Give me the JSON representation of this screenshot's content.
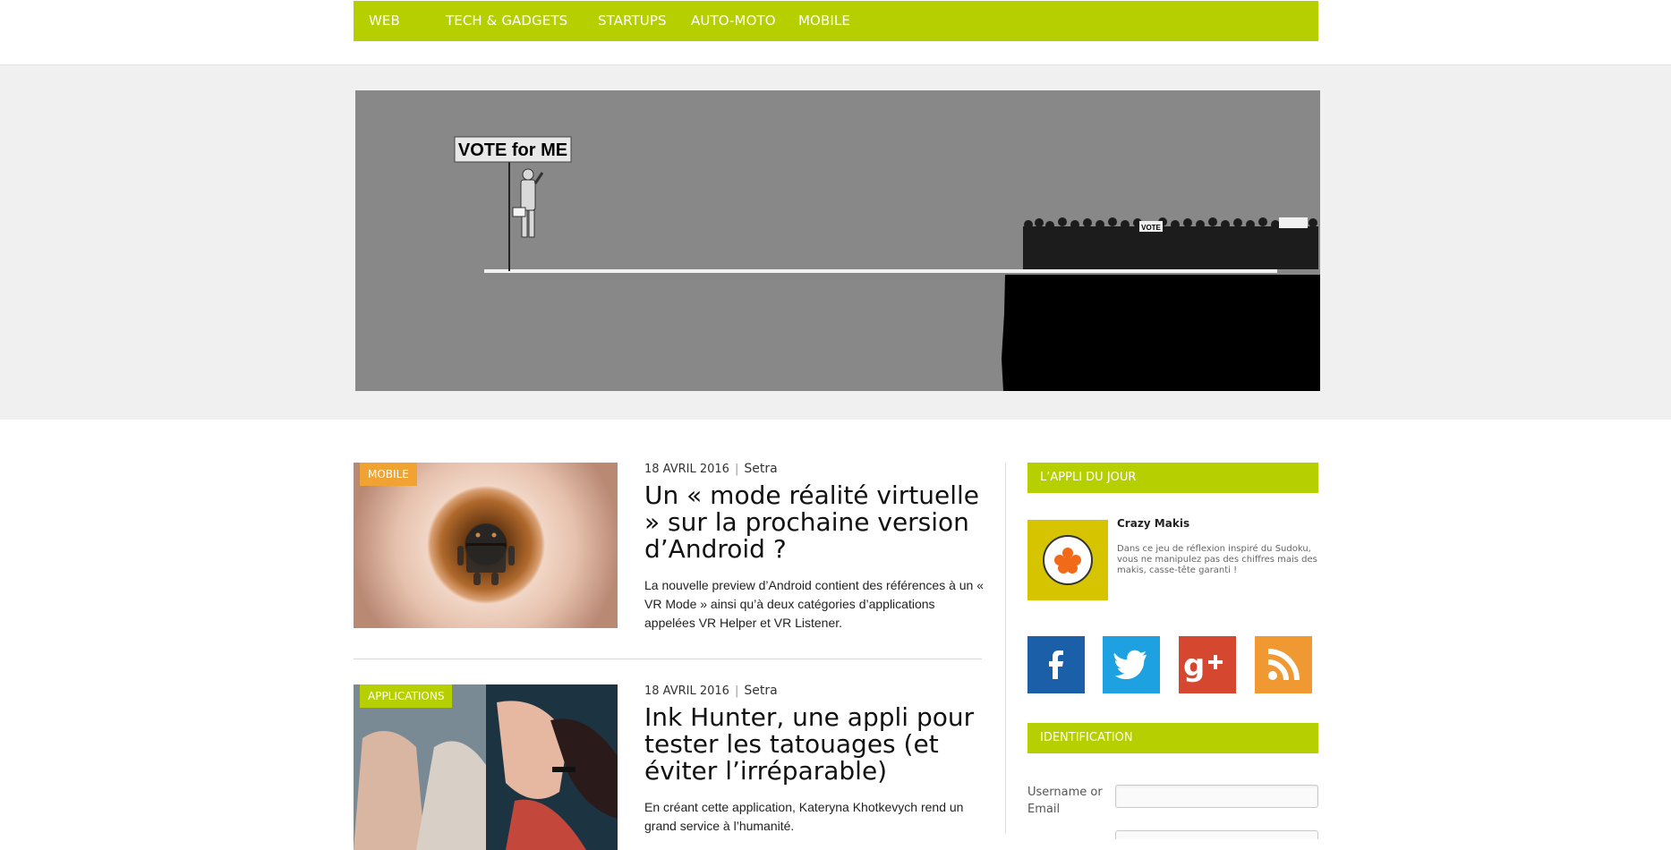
{
  "nav": {
    "items": [
      "WEB",
      "TECH & GADGETS",
      "STARTUPS",
      "AUTO-MOTO",
      "MOBILE"
    ]
  },
  "hero": {
    "sign_text": "VOTE for ME",
    "crowd_sign_text": "VOTE"
  },
  "articles": [
    {
      "category": "MOBILE",
      "category_color": "#f0a232",
      "date": "18 AVRIL 2016",
      "author": "Setra",
      "title": "Un « mode réalité virtuelle » sur la prochaine version d’Android ?",
      "excerpt": "La nouvelle preview d’Android contient des références à un « VR Mode » ainsi qu’à deux catégories d’applications appelées VR Helper et VR Listener.",
      "image_icon": "android-eye-image"
    },
    {
      "category": "APPLICATIONS",
      "category_color": "#b5cf00",
      "date": "18 AVRIL 2016",
      "author": "Setra",
      "title": "Ink Hunter, une appli pour tester les tatouages (et éviter l’irréparable)",
      "excerpt": "En créant cette application, Kateryna Khotkevych rend un grand service à l’humanité.",
      "image_icon": "tattoo-hands-image"
    }
  ],
  "sidebar": {
    "app_of_day": {
      "heading": "L’APPLI DU JOUR",
      "name": "Crazy Makis",
      "description": "Dans ce jeu de réflexion inspiré du Sudoku, vous ne manipulez pas des chiffres mais des makis, casse-tête garanti !",
      "icon": "makis-icon"
    },
    "social": [
      {
        "name": "facebook",
        "icon": "facebook-icon",
        "color": "#1a5fa8"
      },
      {
        "name": "twitter",
        "icon": "twitter-icon",
        "color": "#1da1e0"
      },
      {
        "name": "google-plus",
        "icon": "google-plus-icon",
        "color": "#d6472f"
      },
      {
        "name": "rss",
        "icon": "rss-icon",
        "color": "#f09933"
      }
    ],
    "login": {
      "heading": "IDENTIFICATION",
      "username_label": "Username or Email"
    }
  },
  "colors": {
    "accent": "#b5cf00",
    "band": "#f0f0f0"
  }
}
